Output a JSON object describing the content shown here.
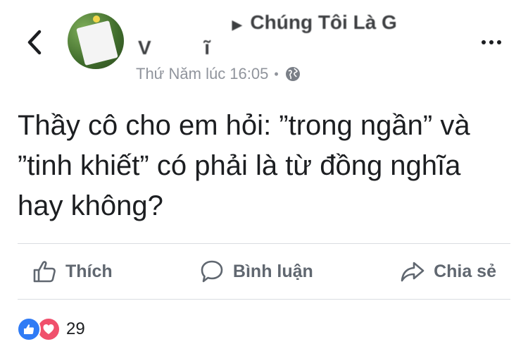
{
  "header": {
    "author_line1": "Chúng Tôi Là G",
    "author_line2": "V",
    "author_line2b": "ĩ",
    "timestamp": "Thứ Năm lúc 16:05",
    "separator": "•",
    "privacy_icon": "globe-icon",
    "back_icon": "chevron-left-icon",
    "more_icon": "more-horizontal-icon"
  },
  "post": {
    "text": "Thầy cô cho em hỏi: ”trong ngần” và ”tinh khiết” có phải là từ đồng nghĩa hay không?"
  },
  "actions": {
    "like_label": "Thích",
    "comment_label": "Bình luận",
    "share_label": "Chia sẻ"
  },
  "reactions": {
    "count": "29",
    "types": [
      "like",
      "love"
    ],
    "like_color": "#2f7bf5",
    "love_color": "#f0506c"
  },
  "colors": {
    "meta_text": "#90949c",
    "action_text": "#606770",
    "divider": "#dadde1"
  }
}
